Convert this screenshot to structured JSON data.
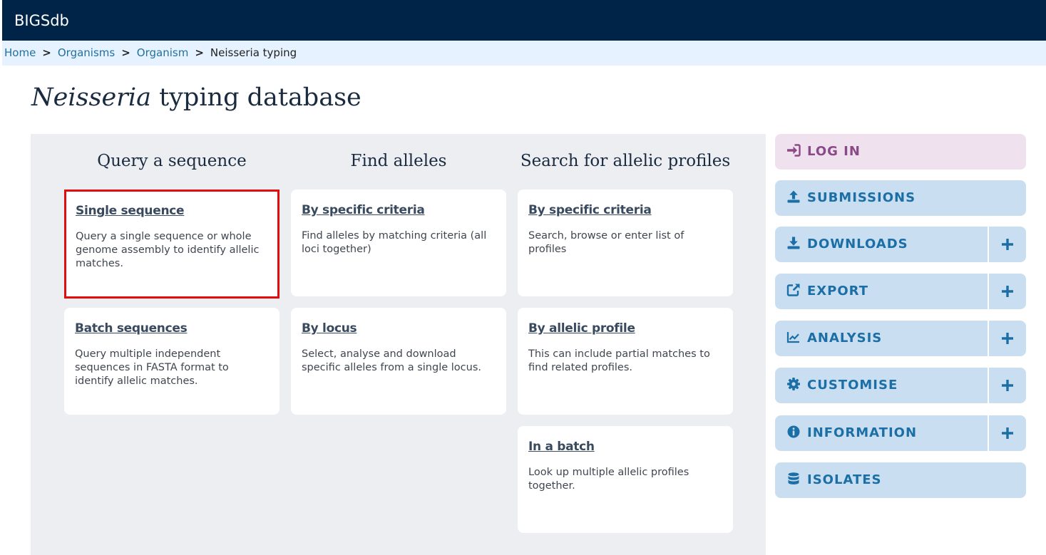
{
  "header": {
    "brand": "BIGSdb"
  },
  "breadcrumb": {
    "items": [
      {
        "label": "Home"
      },
      {
        "label": "Organisms"
      },
      {
        "label": "Organism"
      }
    ],
    "current": "Neisseria typing",
    "separator": ">"
  },
  "page": {
    "title_italic": "Neisseria",
    "title_rest": " typing database"
  },
  "columns": [
    {
      "heading": "Query a sequence",
      "cards": [
        {
          "title": "Single sequence",
          "desc": "Query a single sequence or whole genome assembly to identify allelic matches."
        },
        {
          "title": "Batch sequences",
          "desc": "Query multiple independent sequences in FASTA format to identify allelic matches."
        }
      ]
    },
    {
      "heading": "Find alleles",
      "cards": [
        {
          "title": "By specific criteria",
          "desc": "Find alleles by matching criteria (all loci together)"
        },
        {
          "title": "By locus",
          "desc": "Select, analyse and download specific alleles from a single locus."
        }
      ]
    },
    {
      "heading": "Search for allelic profiles",
      "cards": [
        {
          "title": "By specific criteria",
          "desc": "Search, browse or enter list of profiles"
        },
        {
          "title": "By allelic profile",
          "desc": "This can include partial matches to find related profiles."
        },
        {
          "title": "In a batch",
          "desc": "Look up multiple allelic profiles together."
        }
      ]
    }
  ],
  "sidebar": {
    "login": "LOG IN",
    "submissions": "SUBMISSIONS",
    "downloads": "DOWNLOADS",
    "export": "EXPORT",
    "analysis": "ANALYSIS",
    "customise": "CUSTOMISE",
    "information": "INFORMATION",
    "isolates": "ISOLATES"
  },
  "colors": {
    "header_bg": "#002447",
    "breadcrumb_bg": "#e6f2ff",
    "panel_bg": "#eceef2",
    "menu_bg": "#c9dff1",
    "menu_text": "#1b6fa6",
    "login_bg": "#f0e1ee",
    "login_text": "#894a87",
    "highlight": "#e30d0d"
  },
  "icons": {
    "login": "sign-in-icon",
    "submissions": "upload-icon",
    "downloads": "download-icon",
    "export": "external-link-icon",
    "analysis": "line-chart-icon",
    "customise": "gear-icon",
    "information": "info-circle-icon",
    "isolates": "database-icon",
    "expand": "plus-icon"
  }
}
